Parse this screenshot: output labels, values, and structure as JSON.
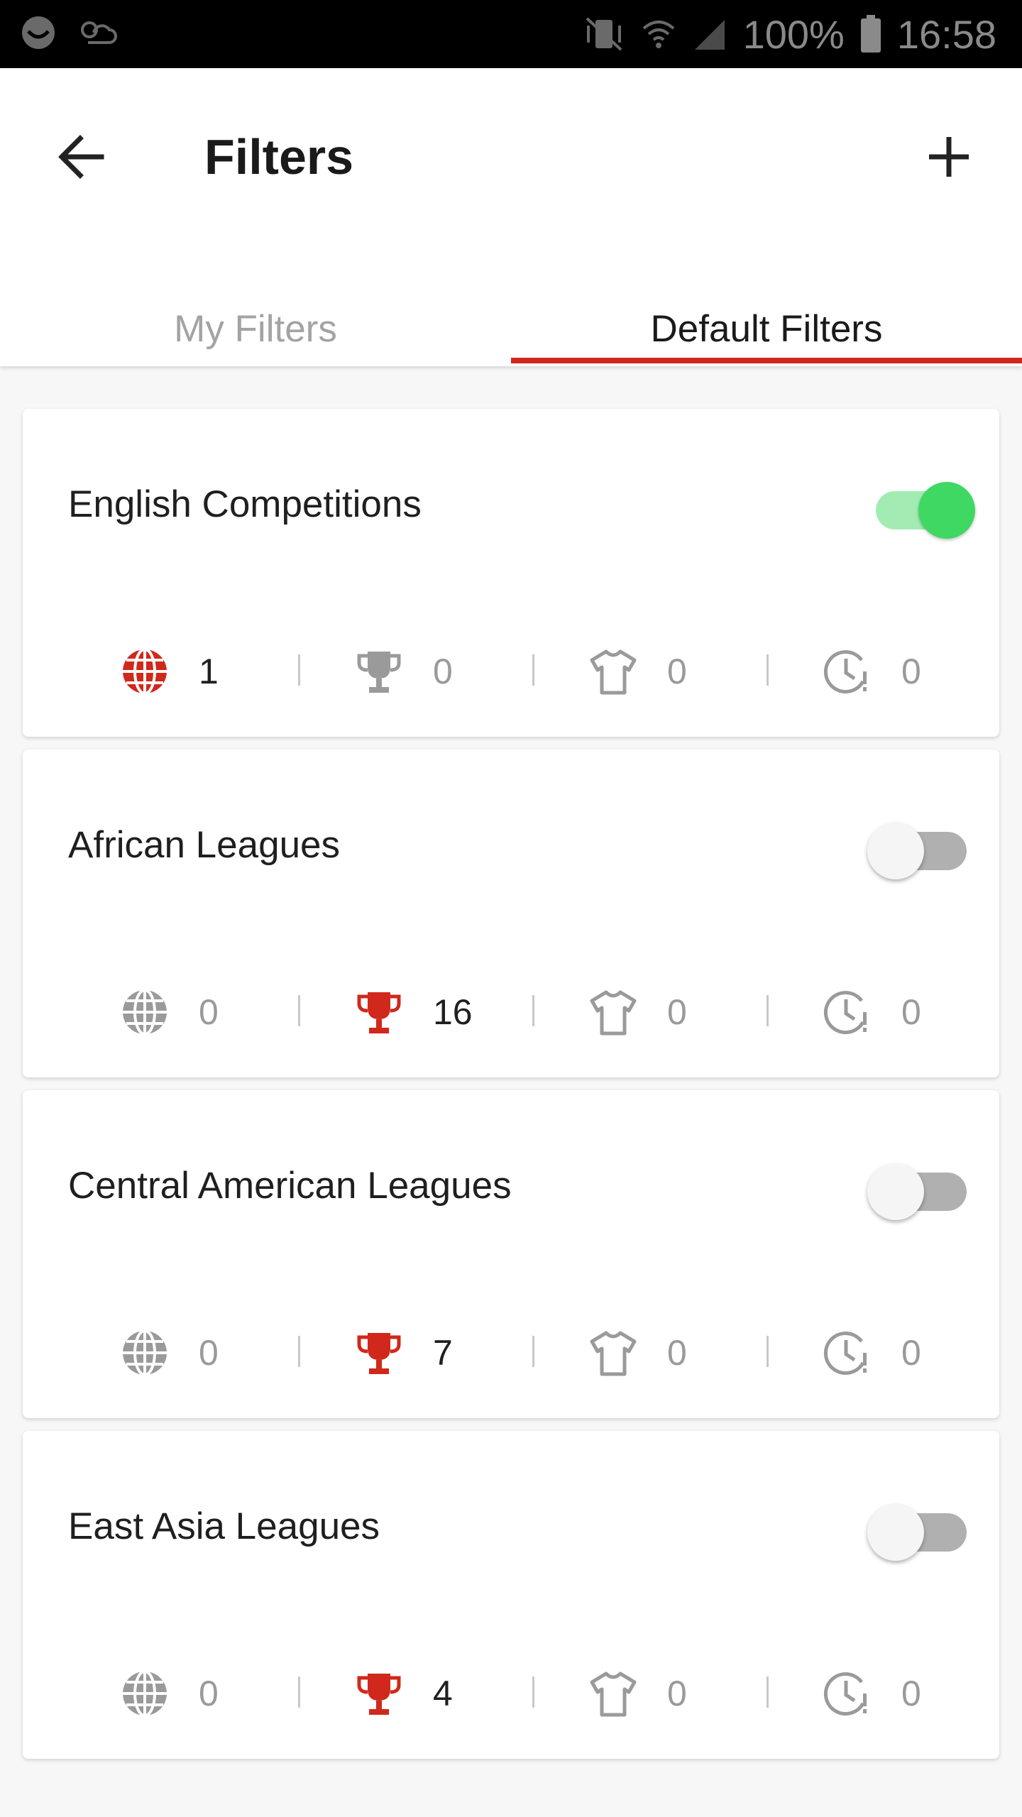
{
  "status_bar": {
    "battery": "100%",
    "time": "16:58",
    "icons": [
      "notification-icon",
      "weather-icon",
      "vibrate-icon",
      "wifi-icon",
      "signal-icon",
      "battery-icon"
    ]
  },
  "header": {
    "title": "Filters",
    "back_icon": "arrow-back-icon",
    "add_icon": "plus-icon"
  },
  "tabs": [
    {
      "label": "My Filters",
      "selected": false
    },
    {
      "label": "Default Filters",
      "selected": true
    }
  ],
  "colors": {
    "accent": "#d0281b",
    "switch_on": "#3fd862",
    "inactive_icon": "#9a9a9a"
  },
  "filters": [
    {
      "name": "English Competitions",
      "enabled": true,
      "stats": [
        {
          "icon": "globe-icon",
          "value": "1",
          "active": true
        },
        {
          "icon": "trophy-icon",
          "value": "0",
          "active": false
        },
        {
          "icon": "shirt-icon",
          "value": "0",
          "active": false
        },
        {
          "icon": "clock-alert-icon",
          "value": "0",
          "active": false
        }
      ]
    },
    {
      "name": "African Leagues",
      "enabled": false,
      "stats": [
        {
          "icon": "globe-icon",
          "value": "0",
          "active": false
        },
        {
          "icon": "trophy-icon",
          "value": "16",
          "active": true
        },
        {
          "icon": "shirt-icon",
          "value": "0",
          "active": false
        },
        {
          "icon": "clock-alert-icon",
          "value": "0",
          "active": false
        }
      ]
    },
    {
      "name": "Central American Leagues",
      "enabled": false,
      "stats": [
        {
          "icon": "globe-icon",
          "value": "0",
          "active": false
        },
        {
          "icon": "trophy-icon",
          "value": "7",
          "active": true
        },
        {
          "icon": "shirt-icon",
          "value": "0",
          "active": false
        },
        {
          "icon": "clock-alert-icon",
          "value": "0",
          "active": false
        }
      ]
    },
    {
      "name": "East Asia Leagues",
      "enabled": false,
      "stats": [
        {
          "icon": "globe-icon",
          "value": "0",
          "active": false
        },
        {
          "icon": "trophy-icon",
          "value": "4",
          "active": true
        },
        {
          "icon": "shirt-icon",
          "value": "0",
          "active": false
        },
        {
          "icon": "clock-alert-icon",
          "value": "0",
          "active": false
        }
      ]
    }
  ]
}
